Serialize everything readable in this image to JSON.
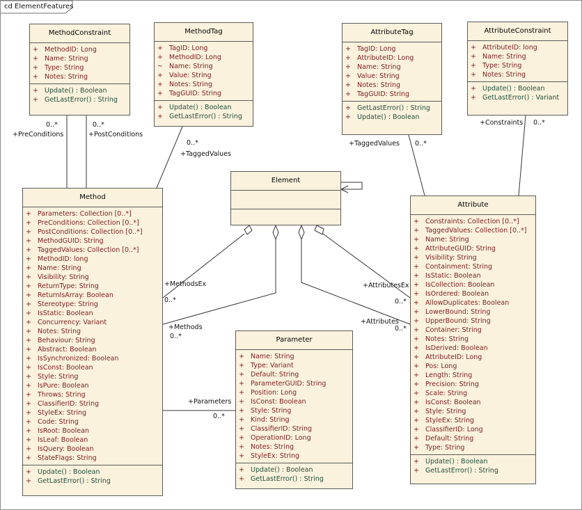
{
  "diagram_title": "cd ElementFeatures",
  "classes": {
    "method_constraint": {
      "name": "MethodConstraint",
      "attributes": [
        {
          "vis": "+",
          "text": "MethodID:  Long"
        },
        {
          "vis": "+",
          "text": "Name:  String"
        },
        {
          "vis": "+",
          "text": "Type:  String"
        },
        {
          "vis": "+",
          "text": "Notes:  String"
        }
      ],
      "operations": [
        {
          "vis": "+",
          "text": "Update() : Boolean"
        },
        {
          "vis": "+",
          "text": "GetLastError() : String"
        }
      ]
    },
    "method_tag": {
      "name": "MethodTag",
      "attributes": [
        {
          "vis": "+",
          "text": "TagID:  Long"
        },
        {
          "vis": "+",
          "text": "MethodID:  Long"
        },
        {
          "vis": "~",
          "text": "Name:  String"
        },
        {
          "vis": "+",
          "text": "Value:  String"
        },
        {
          "vis": "+",
          "text": "Notes:  String"
        },
        {
          "vis": "+",
          "text": "TagGUID:  String"
        }
      ],
      "operations": [
        {
          "vis": "+",
          "text": "Update() : Boolean"
        },
        {
          "vis": "+",
          "text": "GetLastError() : String"
        }
      ]
    },
    "attribute_tag": {
      "name": "AttributeTag",
      "attributes": [
        {
          "vis": "+",
          "text": "TagID:  Long"
        },
        {
          "vis": "+",
          "text": "AttributeID:  Long"
        },
        {
          "vis": "+",
          "text": "Name:  String"
        },
        {
          "vis": "+",
          "text": "Value:  String"
        },
        {
          "vis": "+",
          "text": "Notes:  String"
        },
        {
          "vis": "+",
          "text": "TagGUID:  String"
        }
      ],
      "operations": [
        {
          "vis": "+",
          "text": "GetLastError() : String"
        },
        {
          "vis": "+",
          "text": "Update() : Boolean"
        }
      ]
    },
    "attribute_constraint": {
      "name": "AttributeConstraint",
      "attributes": [
        {
          "vis": "+",
          "text": "AttributeID:  long"
        },
        {
          "vis": "+",
          "text": "Name:  String"
        },
        {
          "vis": "+",
          "text": "Type:  String"
        },
        {
          "vis": "+",
          "text": "Notes:  String"
        }
      ],
      "operations": [
        {
          "vis": "+",
          "text": "Update() : Boolean"
        },
        {
          "vis": "+",
          "text": "GetLastError() : Variant"
        }
      ]
    },
    "element": {
      "name": "Element",
      "attributes": [],
      "operations": []
    },
    "method": {
      "name": "Method",
      "attributes": [
        {
          "vis": "+",
          "text": "Parameters:  Collection [0..*]"
        },
        {
          "vis": "+",
          "text": "PreConditions:  Collection [0..*]"
        },
        {
          "vis": "+",
          "text": "PostConditions:  Collection [0..*]"
        },
        {
          "vis": "+",
          "text": "MethodGUID:  String"
        },
        {
          "vis": "+",
          "text": "TaggedValues:  Collection [0..*]"
        },
        {
          "vis": "+",
          "text": "MethodID:  long"
        },
        {
          "vis": "+",
          "text": "Name:  String"
        },
        {
          "vis": "+",
          "text": "Visibility:  String"
        },
        {
          "vis": "+",
          "text": "ReturnType:  String"
        },
        {
          "vis": "+",
          "text": "ReturnIsArray:  Boolean"
        },
        {
          "vis": "+",
          "text": "Stereotype:  String"
        },
        {
          "vis": "+",
          "text": "IsStatic:  Boolean"
        },
        {
          "vis": "+",
          "text": "Concurrency:  Variant"
        },
        {
          "vis": "+",
          "text": "Notes:  String"
        },
        {
          "vis": "+",
          "text": "Behaviour:  String"
        },
        {
          "vis": "+",
          "text": "Abstract:  Boolean"
        },
        {
          "vis": "+",
          "text": "IsSynchronized:  Boolean"
        },
        {
          "vis": "+",
          "text": "IsConst:  Boolean"
        },
        {
          "vis": "+",
          "text": "Style:  String"
        },
        {
          "vis": "+",
          "text": "IsPure:  Boolean"
        },
        {
          "vis": "+",
          "text": "Throws:  String"
        },
        {
          "vis": "+",
          "text": "ClassifierID:  String"
        },
        {
          "vis": "+",
          "text": "StyleEx:  String"
        },
        {
          "vis": "+",
          "text": "Code:  String"
        },
        {
          "vis": "+",
          "text": "IsRoot:  Boolean"
        },
        {
          "vis": "+",
          "text": "IsLeaf:  Boolean"
        },
        {
          "vis": "+",
          "text": "IsQuery:  Boolean"
        },
        {
          "vis": "+",
          "text": "StateFlags:  String"
        }
      ],
      "operations": [
        {
          "vis": "+",
          "text": "Update() : Boolean"
        },
        {
          "vis": "+",
          "text": "GetLastError() : String"
        }
      ]
    },
    "parameter": {
      "name": "Parameter",
      "attributes": [
        {
          "vis": "+",
          "text": "Name:  String"
        },
        {
          "vis": "+",
          "text": "Type:  Variant"
        },
        {
          "vis": "+",
          "text": "Default:  String"
        },
        {
          "vis": "+",
          "text": "ParameterGUID:  String"
        },
        {
          "vis": "+",
          "text": "Position:  Long"
        },
        {
          "vis": "+",
          "text": "IsConst:  Boolean"
        },
        {
          "vis": "+",
          "text": "Style:  String"
        },
        {
          "vis": "+",
          "text": "Kind:  String"
        },
        {
          "vis": "+",
          "text": "ClassifierID:  String"
        },
        {
          "vis": "+",
          "text": "OperationID:  Long"
        },
        {
          "vis": "+",
          "text": "Notes:  String"
        },
        {
          "vis": "+",
          "text": "StyleEx:  String"
        }
      ],
      "operations": [
        {
          "vis": "+",
          "text": "Update() : Boolean"
        },
        {
          "vis": "+",
          "text": "GetLastError() : String"
        }
      ]
    },
    "attribute": {
      "name": "Attribute",
      "attributes": [
        {
          "vis": "+",
          "text": "Constraints:  Collection [0..*]"
        },
        {
          "vis": "+",
          "text": "TaggedValues:  Collection [0..*]"
        },
        {
          "vis": "+",
          "text": "Name:  String"
        },
        {
          "vis": "+",
          "text": "AttributeGUID:  String"
        },
        {
          "vis": "+",
          "text": "Visibility:  String"
        },
        {
          "vis": "+",
          "text": "Containment:  String"
        },
        {
          "vis": "+",
          "text": "IsStatic:  Boolean"
        },
        {
          "vis": "+",
          "text": "IsCollection:  Boolean"
        },
        {
          "vis": "+",
          "text": "IsOrdered:  Boolean"
        },
        {
          "vis": "+",
          "text": "AllowDuplicates:  Boolean"
        },
        {
          "vis": "+",
          "text": "LowerBound:  String"
        },
        {
          "vis": "+",
          "text": "UpperBound:  String"
        },
        {
          "vis": "+",
          "text": "Container:  String"
        },
        {
          "vis": "+",
          "text": "Notes:  String"
        },
        {
          "vis": "+",
          "text": "IsDerived:  Boolean"
        },
        {
          "vis": "+",
          "text": "AttributeID:  Long"
        },
        {
          "vis": "+",
          "text": "Pos:  Long"
        },
        {
          "vis": "+",
          "text": "Length:  String"
        },
        {
          "vis": "+",
          "text": "Precision:  String"
        },
        {
          "vis": "+",
          "text": "Scale:  String"
        },
        {
          "vis": "+",
          "text": "IsConst:  Boolean"
        },
        {
          "vis": "+",
          "text": "Style:  String"
        },
        {
          "vis": "+",
          "text": "StyleEx:  String"
        },
        {
          "vis": "+",
          "text": "ClassifierID:  Long"
        },
        {
          "vis": "+",
          "text": "Default:  String"
        },
        {
          "vis": "+",
          "text": "Type:  String"
        }
      ],
      "operations": [
        {
          "vis": "+",
          "text": "Update() : Boolean"
        },
        {
          "vis": "+",
          "text": "GetLastError() : String"
        }
      ]
    }
  },
  "associations": {
    "preconditions_role": "+PreConditions",
    "preconditions_mult": "0..*",
    "postconditions_role": "+PostConditions",
    "postconditions_mult": "0..*",
    "method_tagged_role": "+TaggedValues",
    "method_tagged_mult": "0..*",
    "attribute_tagged_role": "+TaggedValues",
    "attribute_tagged_mult": "0..*",
    "constraints_role": "+Constraints",
    "constraints_mult": "0..*",
    "methodsex_role": "+MethodsEx",
    "methodsex_mult": "0..*",
    "methods_role": "+Methods",
    "methods_mult": "0..*",
    "attributesex_role": "+AttributesEx",
    "attributesex_mult": "0..*",
    "attributes_role": "+Attributes",
    "attributes_mult": "0..*",
    "parameters_role": "+Parameters",
    "parameters_mult": "0..*"
  }
}
